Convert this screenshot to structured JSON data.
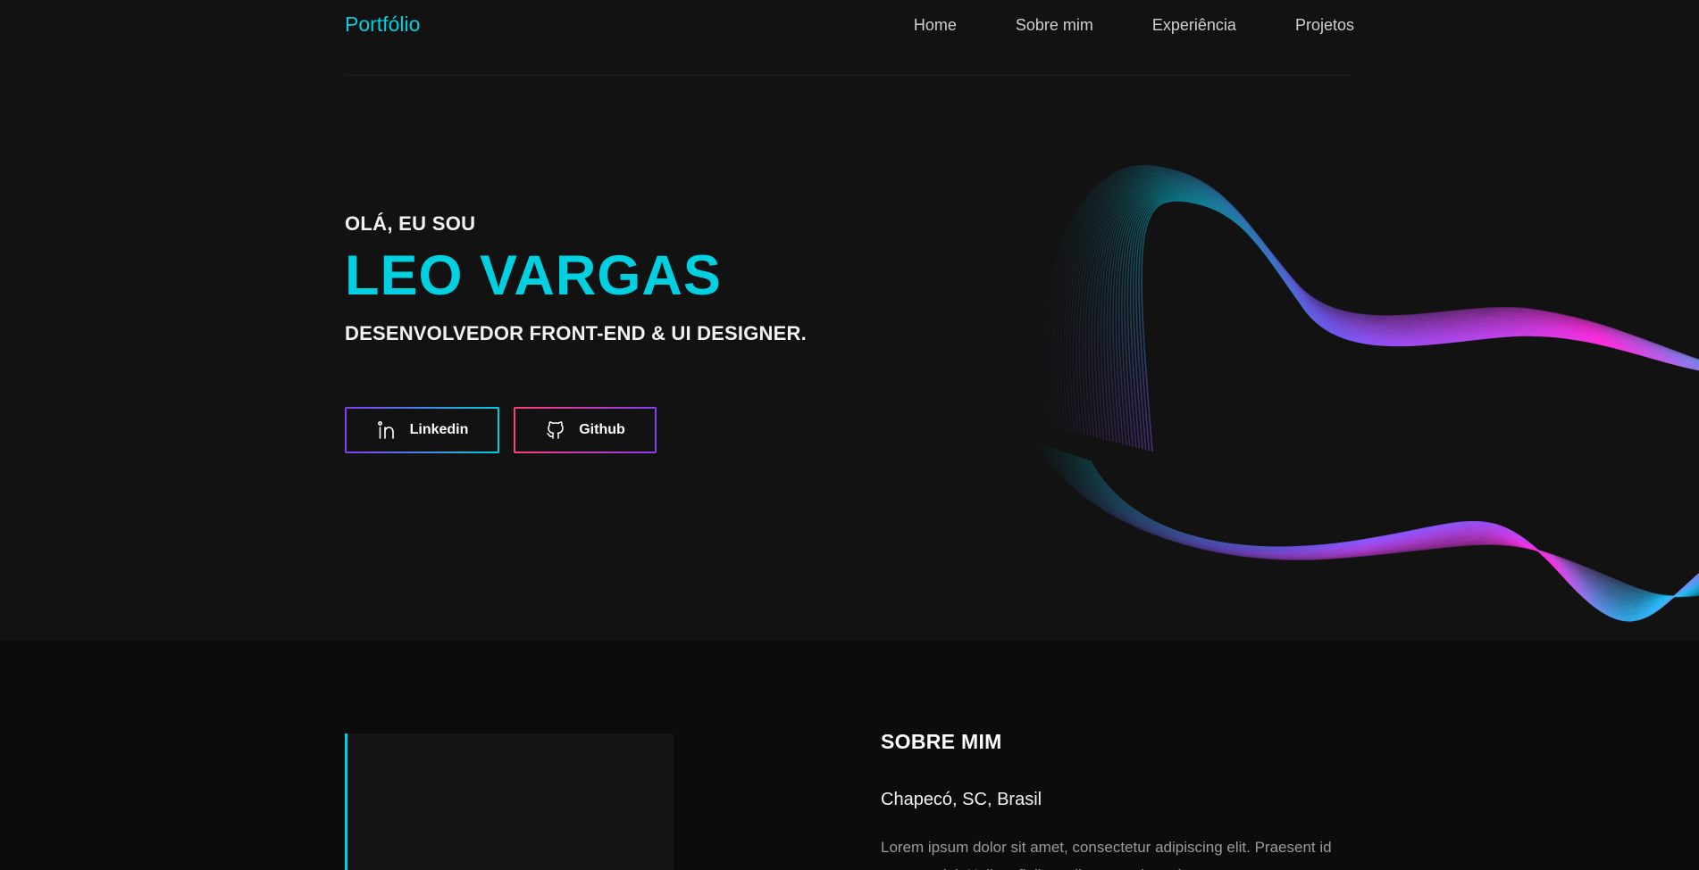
{
  "header": {
    "brand": "Portfólio",
    "nav": [
      "Home",
      "Sobre mim",
      "Experiência",
      "Projetos"
    ]
  },
  "hero": {
    "greeting": "OLÁ, EU SOU",
    "name": "LEO VARGAS",
    "role": "DESENVOLVEDOR FRONT-END & UI DESIGNER.",
    "buttons": {
      "linkedin": "Linkedin",
      "github": "Github"
    }
  },
  "about": {
    "title": "SOBRE MIM",
    "location": "Chapecó, SC, Brasil",
    "paragraph": "Lorem ipsum dolor sit amet, consectetur adipiscing elit. Praesent id egestas dui. Nullam finibus aliquam enim quis"
  },
  "colors": {
    "accent": "#00cfe0",
    "magenta": "#ff2de0",
    "purple": "#8a3cf0",
    "background": "#121212"
  },
  "icons": {
    "linkedin": "linkedin-icon",
    "github": "github-icon"
  }
}
